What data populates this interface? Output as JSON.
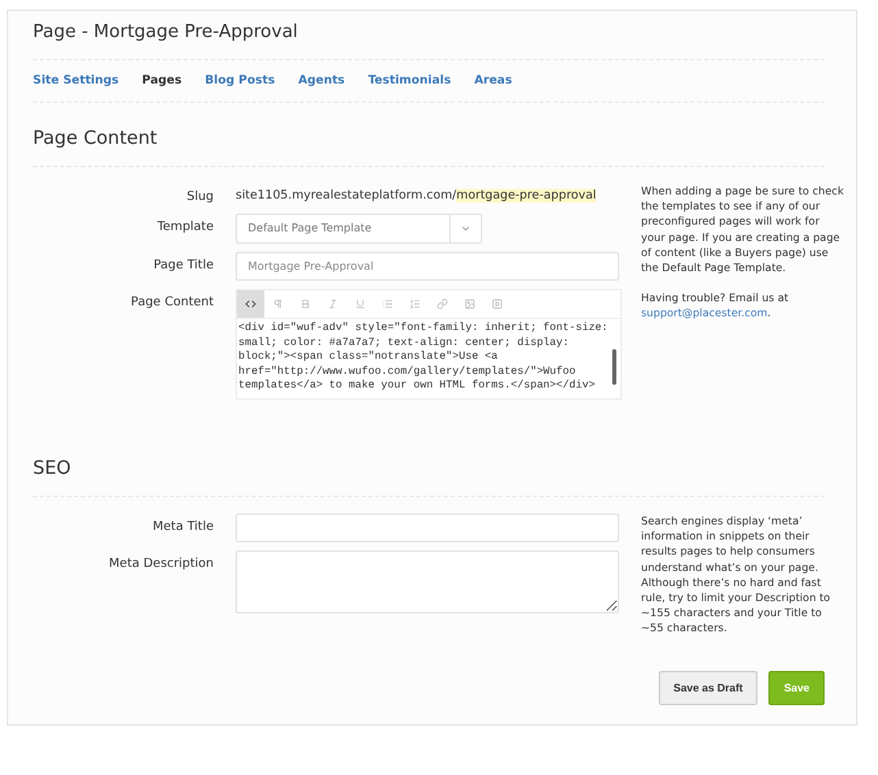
{
  "title": "Page - Mortgage Pre-Approval",
  "tabs": [
    {
      "label": "Site Settings",
      "selected": false
    },
    {
      "label": "Pages",
      "selected": true
    },
    {
      "label": "Blog Posts",
      "selected": false
    },
    {
      "label": "Agents",
      "selected": false
    },
    {
      "label": "Testimonials",
      "selected": false
    },
    {
      "label": "Areas",
      "selected": false
    }
  ],
  "page_content": {
    "heading": "Page Content",
    "slug": {
      "label": "Slug",
      "base": "site1105.myrealestateplatform.com/",
      "highlight": "mortgage-pre-approval"
    },
    "template": {
      "label": "Template",
      "value": "Default Page Template"
    },
    "page_title": {
      "label": "Page Title",
      "placeholder": "Mortgage Pre-Approval"
    },
    "content": {
      "label": "Page Content",
      "toolbar": [
        {
          "kind": "code",
          "selected": true
        },
        {
          "kind": "paragraph",
          "selected": false
        },
        {
          "kind": "bold",
          "selected": false
        },
        {
          "kind": "italic",
          "selected": false
        },
        {
          "kind": "underline",
          "selected": false
        },
        {
          "kind": "bullets",
          "selected": false
        },
        {
          "kind": "numbers",
          "selected": false
        },
        {
          "kind": "link",
          "selected": false
        },
        {
          "kind": "image",
          "selected": false
        },
        {
          "kind": "video",
          "selected": false
        }
      ],
      "lines": [
        "<div id=\"wuf-adv\" style=\"font-family: inherit; font-size:",
        "small; color: #a7a7a7; text-align: center; display:",
        "block;\"><span class=\"notranslate\">Use <a",
        "href=\"http://www.wufoo.com/gallery/templates/\">Wufoo",
        "templates</a> to make your own HTML forms.</span></div>"
      ]
    },
    "help": "When adding a page be sure to check the templates to see if any of our preconfigured pages will work for your page. If you are creating a page of content (like a Buyers page) use the Default Page Template.",
    "trouble": "Having trouble? Email us at",
    "email": "support@placester.com",
    "trouble_end": "."
  },
  "seo": {
    "heading": "SEO",
    "meta_title": {
      "label": "Meta Title"
    },
    "meta_description": {
      "label": "Meta Description"
    },
    "help": "Search engines display ‘meta’ information in snippets on their results pages to help consumers understand what’s on your page. Although there’s no hard and fast rule, try to limit your Description to ~155 characters and your Title to ~55 characters."
  },
  "buttons": [
    {
      "label": "Save as Draft",
      "kind": "secondary"
    },
    {
      "label": "Save",
      "kind": "primary"
    }
  ]
}
